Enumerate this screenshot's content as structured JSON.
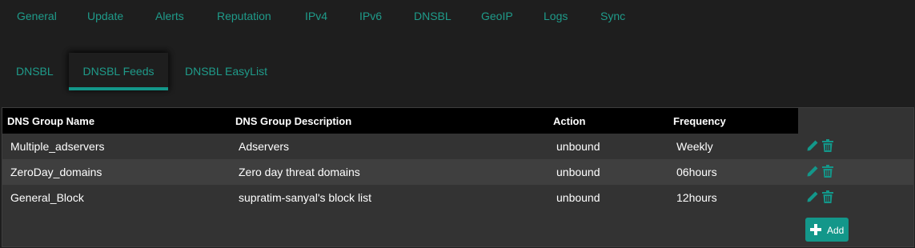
{
  "top_tabs": [
    "General",
    "Update",
    "Alerts",
    "Reputation",
    "IPv4",
    "IPv6",
    "DNSBL",
    "GeoIP",
    "Logs",
    "Sync"
  ],
  "sub_tabs": [
    "DNSBL",
    "DNSBL Feeds",
    "DNSBL EasyList"
  ],
  "active_sub_tab": "DNSBL Feeds",
  "table": {
    "headers": [
      "DNS Group Name",
      "DNS Group Description",
      "Action",
      "Frequency"
    ],
    "rows": [
      {
        "name": "Multiple_adservers",
        "description": "Adservers",
        "action": "unbound",
        "frequency": "Weekly"
      },
      {
        "name": "ZeroDay_domains",
        "description": "Zero day threat domains",
        "action": "unbound",
        "frequency": "06hours"
      },
      {
        "name": "General_Block",
        "description": "supratim-sanyal's block list",
        "action": "unbound",
        "frequency": "12hours"
      }
    ]
  },
  "row_icons": [
    "pencil-icon",
    "trash-icon"
  ],
  "add_button": {
    "label": "Add",
    "icon": "plus-icon"
  },
  "colors": {
    "accent": "#13978a",
    "link": "#1f9b8a",
    "background": "#1e1e1e",
    "panel": "#333333",
    "row_alt": "#3f3f3f",
    "header": "#000000"
  }
}
